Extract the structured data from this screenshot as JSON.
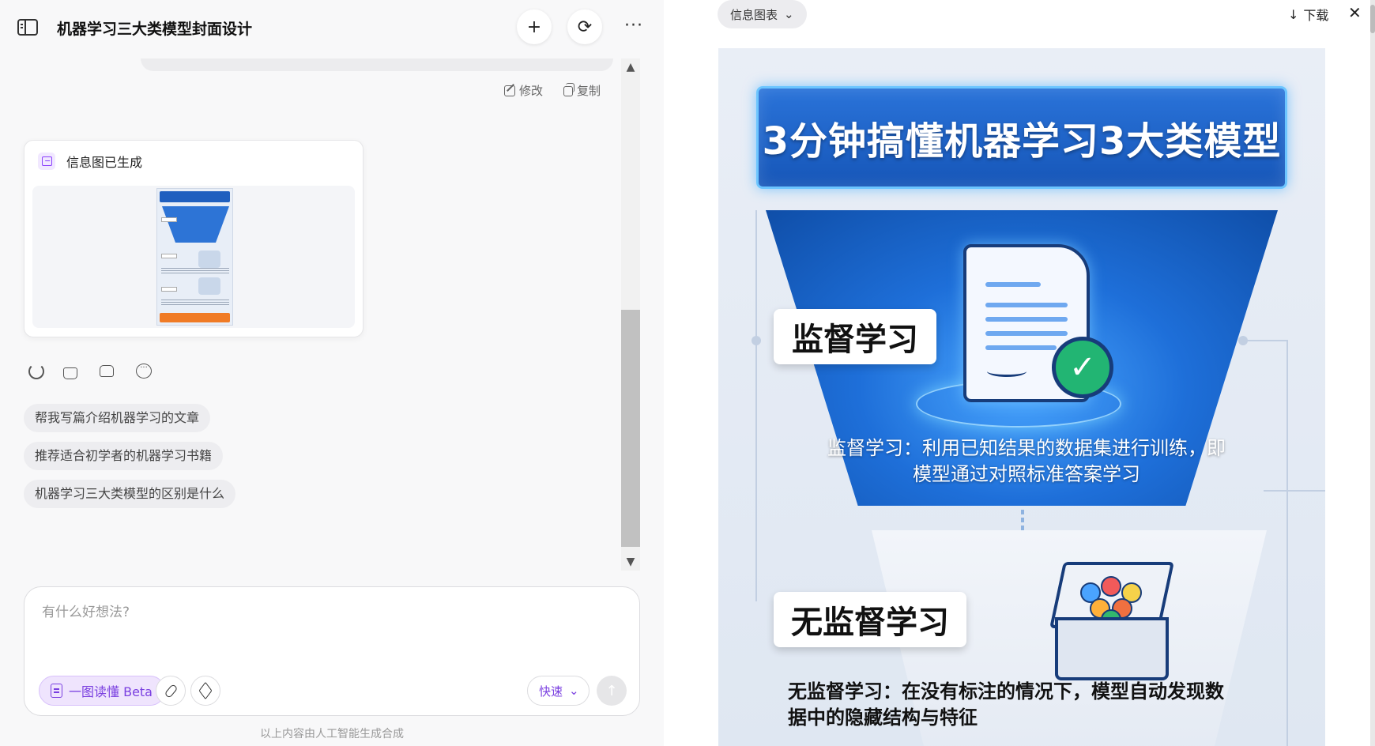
{
  "conversation": {
    "title": "机器学习三大类模型封面设计",
    "actions": {
      "edit": "修改",
      "copy": "复制"
    }
  },
  "result_card": {
    "title": "信息图已生成",
    "icon": "image-icon"
  },
  "suggestions": [
    "帮我写篇介绍机器学习的文章",
    "推荐适合初学者的机器学习书籍",
    "机器学习三大类模型的区别是什么"
  ],
  "composer": {
    "placeholder": "有什么好想法?",
    "mode_pill": "一图读懂 Beta",
    "speed": "快速"
  },
  "disclaimer": "以上内容由人工智能生成合成",
  "preview": {
    "type_label": "信息图表",
    "download_label": "下载",
    "infographic": {
      "title": "3分钟搞懂机器学习3大类模型",
      "sections": [
        {
          "label": "监督学习",
          "description": "监督学习：利用已知结果的数据集进行训练，即模型通过对照标准答案学习"
        },
        {
          "label": "无监督学习",
          "description": "无监督学习：在没有标注的情况下，模型自动发现数据中的隐藏结构与特征"
        }
      ]
    }
  },
  "colors": {
    "accent_purple": "#7a3fe0",
    "banner_blue": "#1656b8",
    "check_green": "#22b573"
  }
}
